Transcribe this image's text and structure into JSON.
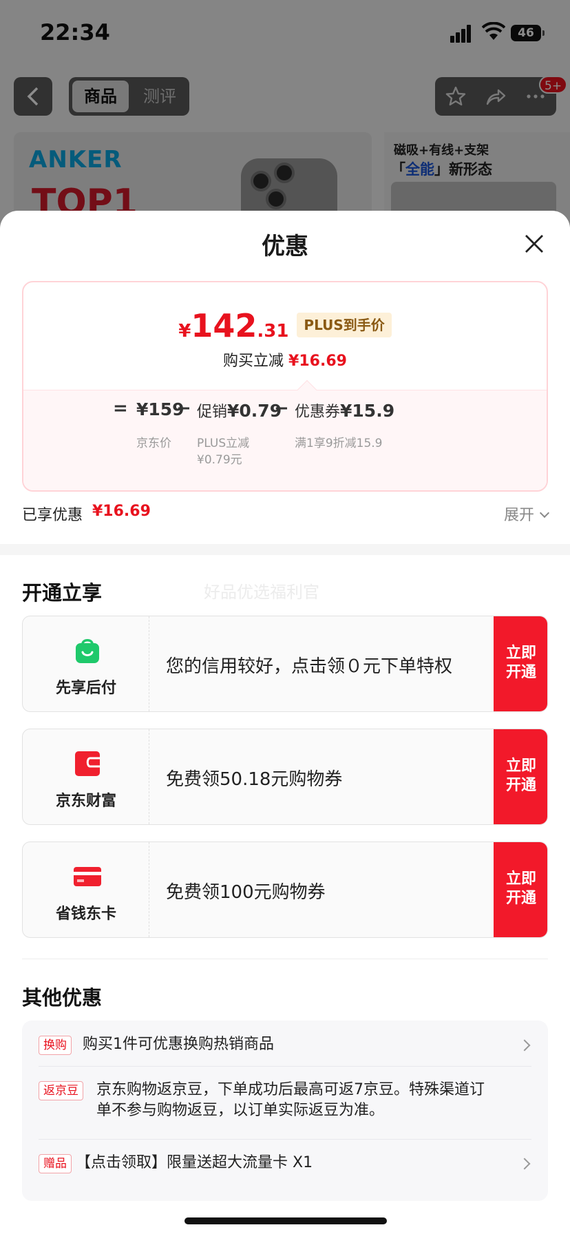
{
  "status_bar": {
    "time": "22:34",
    "battery": "46"
  },
  "nav": {
    "tabs": [
      {
        "label": "商品",
        "active": true
      },
      {
        "label": "测评",
        "active": false
      }
    ],
    "badge": "5+"
  },
  "banner": {
    "brand": "ANKER",
    "headline": "TOP1",
    "right_line1": "磁吸+有线+支架",
    "right_line2_pre": "「",
    "right_line2_em": "全能",
    "right_line2_post": "」新形态"
  },
  "sheet": {
    "title": "优惠",
    "price": {
      "currency": "¥",
      "integer": "142",
      "decimal": ".31",
      "tag": "PLUS到手价",
      "reduce_label": "购买立减",
      "reduce_value": "¥16.69"
    },
    "formula": {
      "equals": "=",
      "minus": "−",
      "base_value": "¥159",
      "base_sub": "京东价",
      "promo_label": "促销",
      "promo_value": "¥0.79",
      "promo_sub_1": "PLUS立减",
      "promo_sub_2": "¥0.79元",
      "coupon_label": "优惠券",
      "coupon_value": "¥15.9",
      "coupon_sub": "满1享9折减15.9"
    },
    "enjoyed": {
      "label": "已享优惠",
      "value": "¥16.69",
      "expand": "展开"
    },
    "open_section": {
      "title": "开通立享",
      "watermark": "好品优选福利官",
      "cards": [
        {
          "name": "先享后付",
          "icon": "shopping-bag-icon",
          "color": "#1fc96b",
          "desc": "您的信用较好，点击领０元下单特权",
          "btn_1": "立即",
          "btn_2": "开通"
        },
        {
          "name": "京东财富",
          "icon": "wallet-icon",
          "color": "#f0202e",
          "desc": "免费领50.18元购物券",
          "btn_1": "立即",
          "btn_2": "开通"
        },
        {
          "name": "省钱东卡",
          "icon": "card-icon",
          "color": "#f0202e",
          "desc": "免费领100元购物券",
          "btn_1": "立即",
          "btn_2": "开通"
        }
      ]
    },
    "other_section": {
      "title": "其他优惠",
      "items": [
        {
          "tag": "换购",
          "text": "购买1件可优惠换购热销商品"
        },
        {
          "tag": "返京豆",
          "text_1": "京东购物返京豆，下单成功后最高可返7京豆。特殊渠道订",
          "text_2": "单不参与购物返豆，以订单实际返豆为准。"
        },
        {
          "tag": "赠品",
          "text": "【点击领取】限量送超大流量卡 X1"
        }
      ]
    }
  },
  "colors": {
    "accent": "#e8121e",
    "plus_tag_bg": "#fdf0d8",
    "green": "#1fc96b"
  }
}
